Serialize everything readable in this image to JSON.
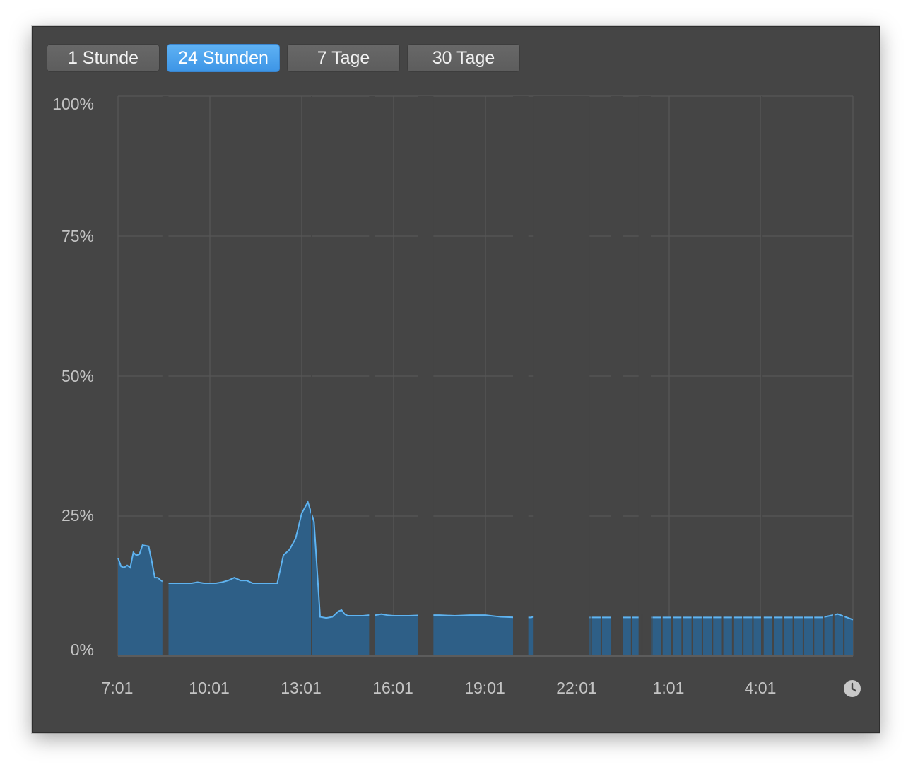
{
  "tabs": [
    {
      "label": "1 Stunde",
      "active": false
    },
    {
      "label": "24 Stunden",
      "active": true
    },
    {
      "label": "7 Tage",
      "active": false
    },
    {
      "label": "30 Tage",
      "active": false
    }
  ],
  "colors": {
    "accent": "#4aa3ee",
    "fill": "#2e5f87",
    "line": "#5fb3f0",
    "background": "#454545",
    "grid": "#555555"
  },
  "icons": {
    "history": "clock-icon"
  },
  "chart_data": {
    "type": "area",
    "title": "",
    "xlabel": "",
    "ylabel": "",
    "ylim": [
      0,
      100
    ],
    "y_ticks": [
      "100%",
      "75%",
      "50%",
      "25%",
      "0%"
    ],
    "x_ticks": [
      "7:01",
      "10:01",
      "13:01",
      "16:01",
      "19:01",
      "22:01",
      "1:01",
      "4:01"
    ],
    "grid": true,
    "series": [
      {
        "unit": "%",
        "x_hours": [
          0,
          0.1,
          0.2,
          0.3,
          0.4,
          0.5,
          0.6,
          0.7,
          0.8,
          1.0,
          1.1,
          1.2,
          1.3,
          1.4,
          1.5,
          1.6,
          1.65,
          1.75,
          1.85,
          2.0,
          2.2,
          2.4,
          2.6,
          2.8,
          3.0,
          3.2,
          3.4,
          3.6,
          3.8,
          4.0,
          4.2,
          4.4,
          4.6,
          4.8,
          5.0,
          5.2,
          5.4,
          5.6,
          5.8,
          6.0,
          6.2,
          6.4,
          6.6,
          6.8,
          7.0,
          7.1,
          7.2,
          7.3,
          7.4,
          7.5,
          7.6,
          7.7,
          7.8,
          7.9,
          8.0,
          8.2,
          8.4,
          8.6,
          8.8,
          9.0,
          9.5,
          10.0,
          10.5,
          11.0,
          11.5,
          12.0,
          12.5,
          13.0,
          13.5,
          14.0,
          14.5,
          15.0,
          15.5,
          16.0,
          16.5,
          17.0,
          17.5,
          18.0,
          18.5,
          19.0,
          19.5,
          20.0,
          20.5,
          21.0,
          21.5,
          22.0,
          22.5,
          23.0,
          23.5,
          24.0
        ],
        "values": [
          17.5,
          16.0,
          15.8,
          16.2,
          15.8,
          18.5,
          18.0,
          18.2,
          19.8,
          19.6,
          17.0,
          14.0,
          14.0,
          13.5,
          13.2,
          13.0,
          13.0,
          13.0,
          13.0,
          13.0,
          13.0,
          13.0,
          13.2,
          13.0,
          13.0,
          13.0,
          13.2,
          13.5,
          14.0,
          13.5,
          13.5,
          13.0,
          13.0,
          13.0,
          13.0,
          13.0,
          18.0,
          19.0,
          21.0,
          25.5,
          27.5,
          24.0,
          7.0,
          6.8,
          7.0,
          7.5,
          8.0,
          8.2,
          7.5,
          7.2,
          7.2,
          7.2,
          7.2,
          7.2,
          7.2,
          7.3,
          7.3,
          7.5,
          7.3,
          7.2,
          7.2,
          7.3,
          7.3,
          7.2,
          7.3,
          7.3,
          7.0,
          6.9,
          6.9,
          8.0,
          6.9,
          6.9,
          6.9,
          6.9,
          6.9,
          6.9,
          6.9,
          6.9,
          6.9,
          6.9,
          6.9,
          6.9,
          6.9,
          6.9,
          6.9,
          6.9,
          6.9,
          6.9,
          7.5,
          6.5
        ],
        "gaps_hours": [
          [
            1.45,
            1.65
          ],
          [
            6.3,
            6.32
          ],
          [
            8.2,
            8.4
          ],
          [
            9.8,
            10.3
          ],
          [
            12.9,
            13.4
          ],
          [
            13.55,
            15.4
          ],
          [
            16.1,
            16.5
          ],
          [
            17.0,
            17.4
          ],
          [
            21.0,
            21.05
          ]
        ]
      }
    ]
  }
}
